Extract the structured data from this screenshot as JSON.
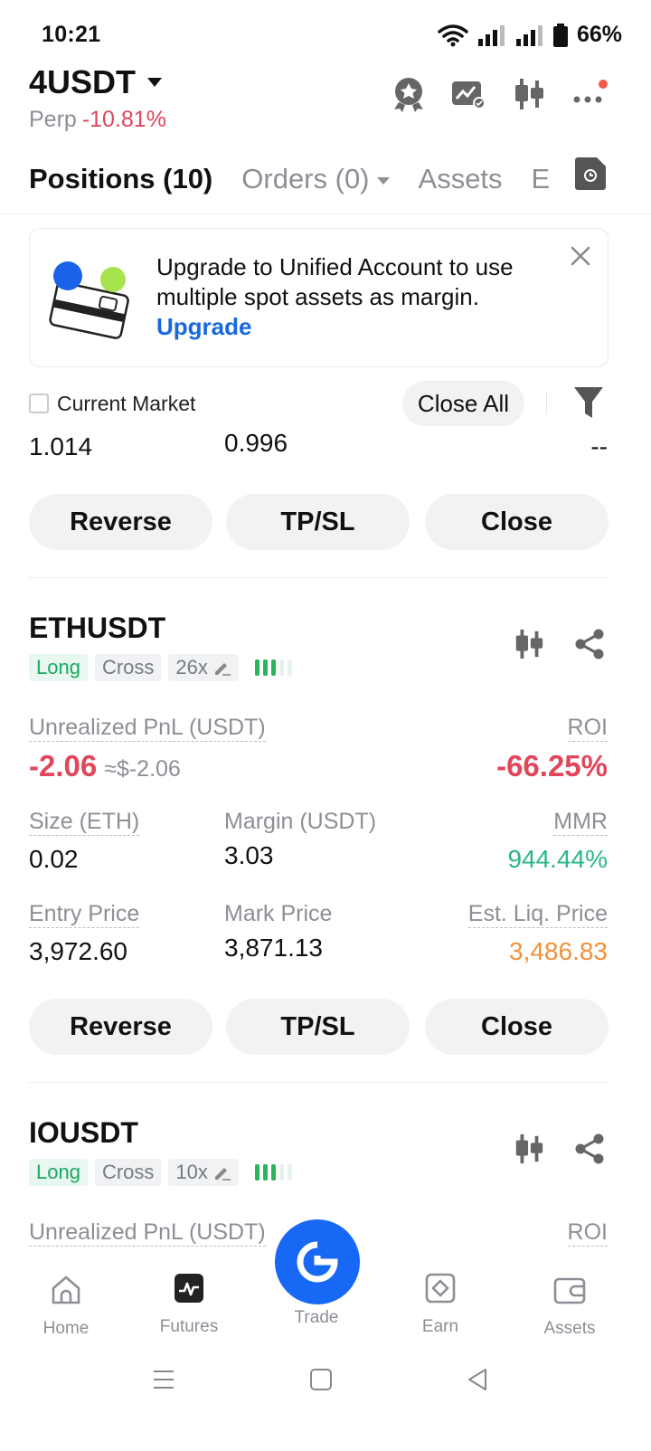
{
  "status": {
    "time": "10:21",
    "battery": "66%"
  },
  "header": {
    "pair": "4USDT",
    "type": "Perp",
    "change": "-10.81%"
  },
  "tabs": [
    {
      "label": "Positions (10)",
      "active": true
    },
    {
      "label": "Orders (0)",
      "active": false
    },
    {
      "label": "Assets",
      "active": false
    },
    {
      "label": "E",
      "active": false
    }
  ],
  "banner": {
    "text": "Upgrade to Unified Account to use multiple spot assets as margin.",
    "link": "Upgrade"
  },
  "filter": {
    "checkbox_label": "Current Market",
    "close_all": "Close All"
  },
  "partial_position": {
    "v1": "1.014",
    "v2": "0.996",
    "v3": "--",
    "buttons": {
      "reverse": "Reverse",
      "tpsl": "TP/SL",
      "close": "Close"
    }
  },
  "positions": [
    {
      "symbol": "ETHUSDT",
      "side": "Long",
      "margin_mode": "Cross",
      "leverage": "26x",
      "pnl_label": "Unrealized PnL (USDT)",
      "pnl": "-2.06",
      "pnl_usd": "≈$-2.06",
      "roi_label": "ROI",
      "roi": "-66.25%",
      "size_label": "Size (ETH)",
      "size": "0.02",
      "margin_label": "Margin (USDT)",
      "margin": "3.03",
      "mmr_label": "MMR",
      "mmr": "944.44%",
      "entry_label": "Entry Price",
      "entry": "3,972.60",
      "mark_label": "Mark Price",
      "mark": "3,871.13",
      "liq_label": "Est. Liq. Price",
      "liq": "3,486.83",
      "buttons": {
        "reverse": "Reverse",
        "tpsl": "TP/SL",
        "close": "Close"
      }
    },
    {
      "symbol": "IOUSDT",
      "side": "Long",
      "margin_mode": "Cross",
      "leverage": "10x",
      "pnl_label": "Unrealized PnL (USDT)",
      "roi_label": "ROI"
    }
  ],
  "nav": [
    {
      "label": "Home",
      "icon": "home-icon"
    },
    {
      "label": "Futures",
      "icon": "futures-icon"
    },
    {
      "label": "Trade",
      "icon": "trade-icon"
    },
    {
      "label": "Earn",
      "icon": "earn-icon"
    },
    {
      "label": "Assets",
      "icon": "assets-icon"
    }
  ],
  "colors": {
    "accent": "#1768f5",
    "negative": "#e0475a",
    "positive": "#2bb58a",
    "warning": "#f2913a"
  }
}
